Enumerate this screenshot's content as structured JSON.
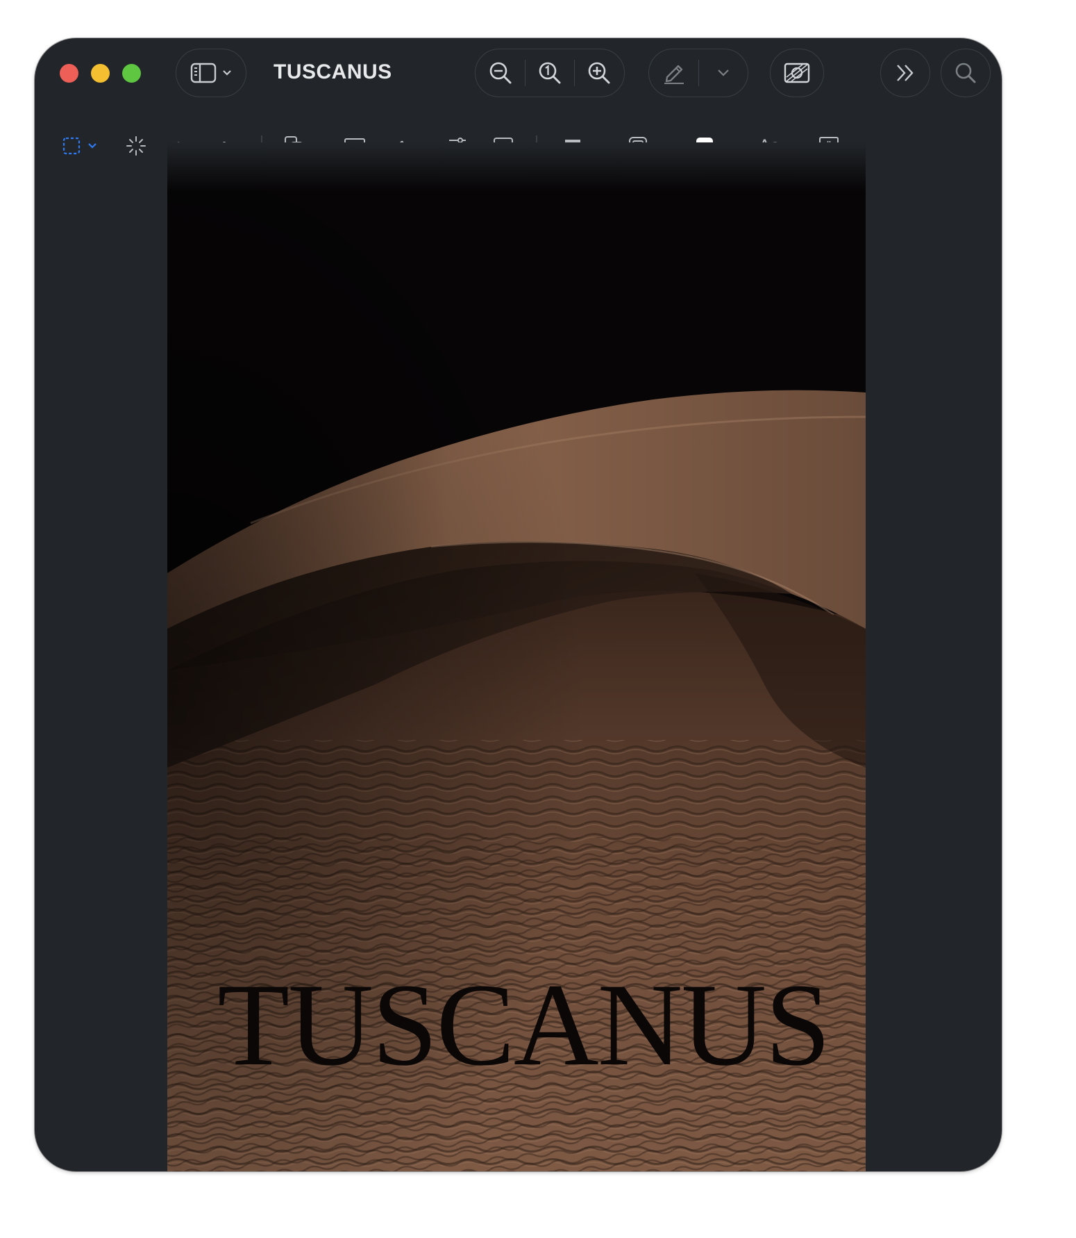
{
  "window": {
    "title": "TUSCANUS"
  },
  "titlebar": {
    "traffic_lights": [
      {
        "name": "close",
        "color": "#ed5f57"
      },
      {
        "name": "minimize",
        "color": "#f4bf30"
      },
      {
        "name": "zoom",
        "color": "#5ec641"
      }
    ],
    "buttons": {
      "sidebar": "sidebar-toggle-icon",
      "zoom_out": "zoom-out-icon",
      "actual_size": "actual-size-icon",
      "zoom_in": "zoom-in-icon",
      "markup": "pencil-icon",
      "markup_menu": "chevron-down-icon",
      "photo_edit": "photo-adjust-icon",
      "more": "chevron-double-right-icon",
      "search": "search-icon"
    }
  },
  "toolbar": {
    "tools": [
      "rectangular-selection-icon",
      "instant-alpha-icon",
      "sketch-icon",
      "draw-icon",
      "shapes-icon",
      "text-box-icon",
      "signature-icon",
      "adjust-color-icon",
      "adjust-size-icon",
      "shape-style-icon",
      "border-color-icon",
      "fill-color-icon",
      "text-style-icon",
      "note-icon"
    ],
    "text_style_label": "Aa",
    "accent_color": "#2f7bf5",
    "fill_color": "#ffffff"
  },
  "document": {
    "poster_title": "TUSCANUS",
    "image": "desert-sand-dunes"
  }
}
